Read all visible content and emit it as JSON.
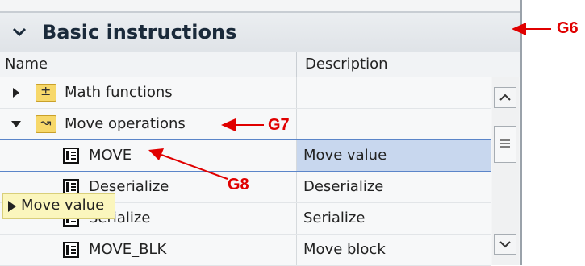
{
  "header": {
    "title": "Basic instructions"
  },
  "columns": {
    "name": "Name",
    "description": "Description"
  },
  "rows": [
    {
      "name": "Math functions",
      "description": "",
      "type": "folder",
      "expanded": false,
      "folder_icon": "±"
    },
    {
      "name": "Move operations",
      "description": "",
      "type": "folder",
      "expanded": true,
      "folder_icon": "↝"
    },
    {
      "name": "MOVE",
      "description": "Move value",
      "type": "block",
      "selected": true
    },
    {
      "name": "Deserialize",
      "description": "Deserialize",
      "type": "block"
    },
    {
      "name": "Serialize",
      "description": "Serialize",
      "type": "block"
    },
    {
      "name": "MOVE_BLK",
      "description": "Move block",
      "type": "block"
    }
  ],
  "tooltip": {
    "text": "Move value"
  },
  "callouts": {
    "g6": "G6",
    "g7": "G7",
    "g8": "G8"
  },
  "colors": {
    "callout": "#e00000",
    "selection": "#c8d7ee",
    "tooltip": "#fbf6bd"
  }
}
